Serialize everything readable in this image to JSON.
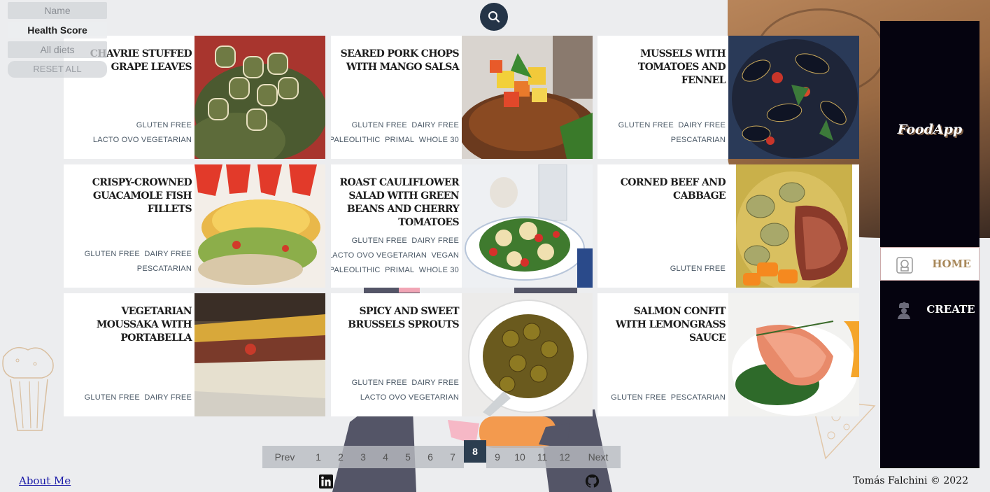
{
  "filters": {
    "name": "Name",
    "health_score": "Health Score",
    "diets": "All diets",
    "reset": "RESET ALL"
  },
  "sidebar": {
    "logo": "FoodApp",
    "home": "HOME",
    "create": "CREATE"
  },
  "recipes": [
    {
      "title": "CHAVRIE STUFFED GRAPE LEAVES",
      "diets": [
        "GLUTEN FREE",
        "LACTO OVO VEGETARIAN"
      ]
    },
    {
      "title": "SEARED PORK CHOPS WITH MANGO SALSA",
      "diets": [
        "GLUTEN FREE",
        "DAIRY FREE",
        "PALEOLITHIC",
        "PRIMAL",
        "WHOLE 30"
      ]
    },
    {
      "title": "MUSSELS WITH TOMATOES AND FENNEL",
      "diets": [
        "GLUTEN FREE",
        "DAIRY FREE",
        "PESCATARIAN"
      ]
    },
    {
      "title": "CRISPY-CROWNED GUACAMOLE FISH FILLETS",
      "diets": [
        "GLUTEN FREE",
        "DAIRY FREE",
        "PESCATARIAN"
      ]
    },
    {
      "title": "ROAST CAULIFLOWER SALAD WITH GREEN BEANS AND CHERRY TOMATOES",
      "diets": [
        "GLUTEN FREE",
        "DAIRY FREE",
        "LACTO OVO VEGETARIAN",
        "VEGAN",
        "PALEOLITHIC",
        "PRIMAL",
        "WHOLE 30"
      ]
    },
    {
      "title": "CORNED BEEF AND CABBAGE",
      "diets": [
        "GLUTEN FREE"
      ]
    },
    {
      "title": "VEGETARIAN MOUSSAKA WITH PORTABELLA",
      "diets": [
        "GLUTEN FREE",
        "DAIRY FREE"
      ]
    },
    {
      "title": "SPICY AND SWEET BRUSSELS SPROUTS",
      "diets": [
        "GLUTEN FREE",
        "DAIRY FREE",
        "LACTO OVO VEGETARIAN"
      ]
    },
    {
      "title": "SALMON CONFIT WITH LEMONGRASS SAUCE",
      "diets": [
        "GLUTEN FREE",
        "PESCATARIAN"
      ]
    }
  ],
  "pagination": {
    "prev": "Prev",
    "next": "Next",
    "pages": [
      "1",
      "2",
      "3",
      "4",
      "5",
      "6",
      "7",
      "8",
      "9",
      "10",
      "11",
      "12"
    ],
    "current": "8"
  },
  "footer": {
    "about": "About Me",
    "copyright": "Tomás Falchini © 2022"
  },
  "colors": {
    "sidebar_bg": "#05030f",
    "search_bg": "#243447",
    "pagination_current": "#2c3e50",
    "home_accent": "#a8885a"
  },
  "icons": [
    "search-icon",
    "linkedin-icon",
    "github-icon",
    "chef-hat-icon",
    "chef-icon"
  ]
}
